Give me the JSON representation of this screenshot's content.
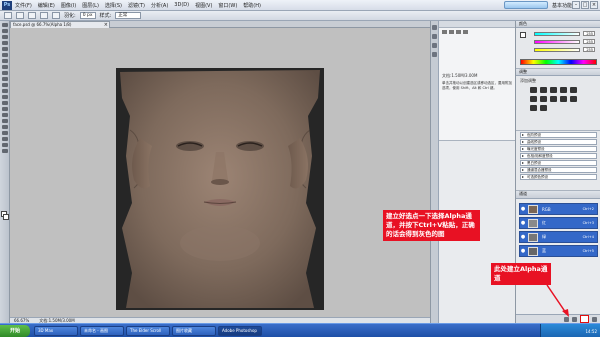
{
  "menubar": {
    "logo": "Ps",
    "items": [
      "文件(F)",
      "编辑(E)",
      "图像(I)",
      "图层(L)",
      "选择(S)",
      "滤镜(T)",
      "分析(A)",
      "3D(D)",
      "视图(V)",
      "窗口(W)",
      "帮助(H)"
    ],
    "workspace": "基本功能"
  },
  "optbar": {
    "feather_label": "羽化:",
    "feather_value": "0 px",
    "style_label": "样式:",
    "style_value": "正常"
  },
  "document": {
    "tab_title": "face.psd @ 66.7%(Alpha 1/8)"
  },
  "statusbar": {
    "zoom": "66.67%",
    "doc_info": "文档:1.50M/3.00M"
  },
  "infopanel": {
    "doc_text": "文档:1.50M/3.00M",
    "hint_text": "单击并拖动以创建选区或移动选区，要用附加选项，使用 Shift、Alt 和 Ctrl 键。"
  },
  "colorpanel": {
    "tab": "颜色",
    "r": "255",
    "g": "255",
    "b": "255"
  },
  "adjpanel": {
    "tab": "调整",
    "title": "添加调整"
  },
  "presets": [
    "色阶预设",
    "曲线预设",
    "曝光度预设",
    "色相/饱和度预设",
    "黑白预设",
    "通道混合器预设",
    "可选颜色预设"
  ],
  "layerspanel": {
    "tab": "通道",
    "layers": [
      {
        "name": "RGB",
        "shortcut": "Ctrl+2"
      },
      {
        "name": "红",
        "shortcut": "Ctrl+3"
      },
      {
        "name": "绿",
        "shortcut": "Ctrl+4"
      },
      {
        "name": "蓝",
        "shortcut": "Ctrl+5"
      }
    ]
  },
  "annotations": {
    "note1": "建立好选点一下选择Alpha通道，并按下Ctrl+V粘贴，正确的话会得到灰色的图",
    "note2": "此处建立Alpha通道"
  },
  "taskbar": {
    "start": "开始",
    "tasks": [
      "3D Max",
      "未命名 - 画图",
      "The Elder Scroll",
      "图片收藏",
      "Adobe Photoshop"
    ],
    "clock": "14:52"
  }
}
